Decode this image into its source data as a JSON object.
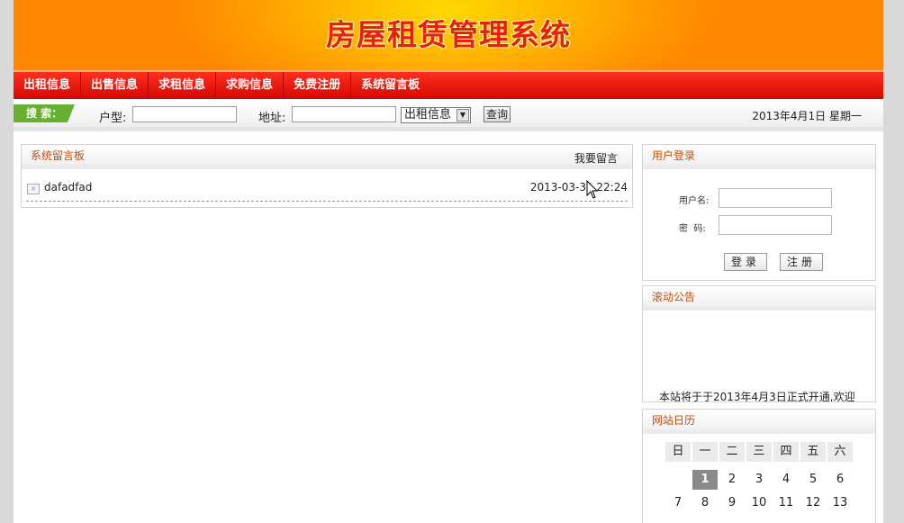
{
  "header": {
    "title": "房屋租赁管理系统"
  },
  "nav": {
    "items": [
      "出租信息",
      "出售信息",
      "求租信息",
      "求购信息",
      "免费注册",
      "系统留言板"
    ]
  },
  "search": {
    "tag": "搜 索：",
    "type_label": "户型:",
    "type_value": "",
    "address_label": "地址:",
    "address_value": "",
    "category_selected": "出租信息",
    "query_button": "查询",
    "date": "2013年4月1日 星期一"
  },
  "board": {
    "title": "系统留言板",
    "more_link": "我要留言",
    "messages": [
      {
        "title": "dafadfad",
        "time": "2013-03-31 22:24"
      }
    ]
  },
  "login": {
    "title": "用户登录",
    "username_label": "用户名:",
    "password_label": "密  码:",
    "username_value": "",
    "password_value": "",
    "login_button": "登录",
    "register_button": "注册"
  },
  "notice": {
    "title": "滚动公告",
    "text": "本站将于于2013年4月3日正式开通,欢迎"
  },
  "calendar": {
    "title": "网站日历",
    "weekdays": [
      "日",
      "一",
      "二",
      "三",
      "四",
      "五",
      "六"
    ],
    "week1": [
      "",
      "1",
      "2",
      "3",
      "4",
      "5",
      "6"
    ],
    "week2": [
      "7",
      "8",
      "9",
      "10",
      "11",
      "12",
      "13"
    ],
    "today": "1"
  }
}
